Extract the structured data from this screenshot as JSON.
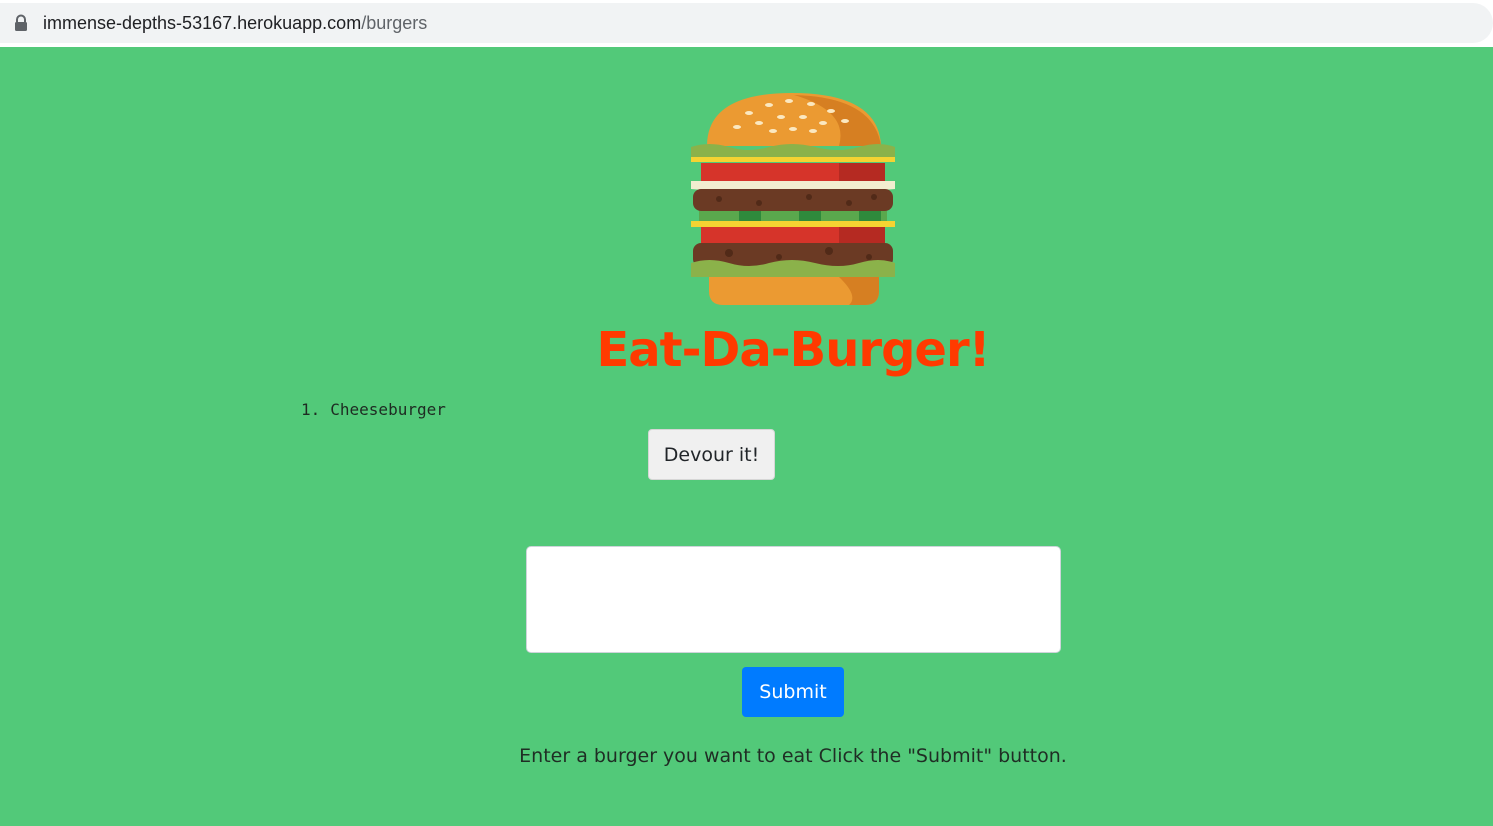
{
  "browser": {
    "url_host": "immense-depths-53167.herokuapp.com",
    "url_path": "/burgers",
    "lock_icon": "lock-icon"
  },
  "page": {
    "logo_icon": "burger-icon",
    "title": "Eat-Da-Burger!",
    "burgers": [
      {
        "number": "1.",
        "name": "Cheeseburger",
        "button_label": "Devour it!"
      }
    ],
    "input_value": "",
    "submit_label": "Submit",
    "instructions": "Enter a burger you want to eat Click the \"Submit\" button."
  },
  "colors": {
    "background": "#52c979",
    "title": "#ff3a00",
    "submit": "#007bff"
  }
}
